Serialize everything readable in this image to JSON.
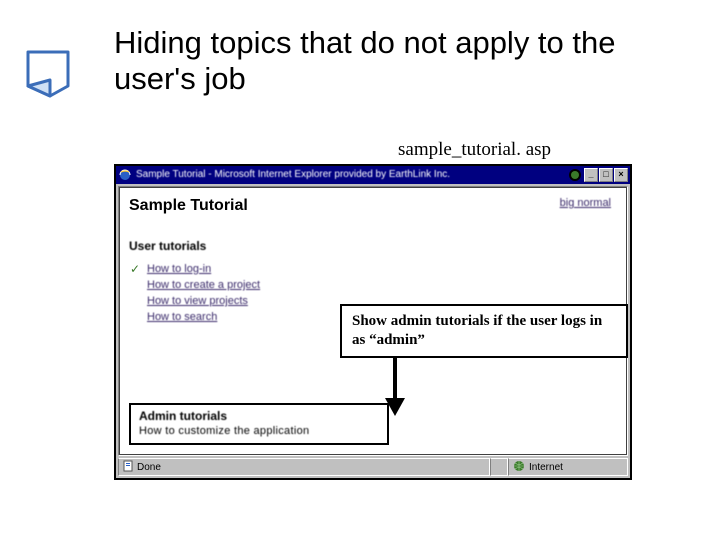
{
  "slide": {
    "title": "Hiding topics that do not apply to the user's job",
    "filename": "sample_tutorial. asp"
  },
  "browser": {
    "titlebar": "Sample Tutorial - Microsoft Internet Explorer provided by EarthLink Inc.",
    "statusbar_left": "Done",
    "statusbar_right": "Internet"
  },
  "page": {
    "heading": "Sample Tutorial",
    "zoom_link": "big normal",
    "user_section": "User tutorials",
    "links": [
      "How to log-in",
      "How to create a project",
      "How to view projects",
      "How to search"
    ],
    "admin_section": "Admin tutorials",
    "admin_link": "How to customize the application"
  },
  "callout": "Show admin tutorials if the user logs in as “admin”"
}
